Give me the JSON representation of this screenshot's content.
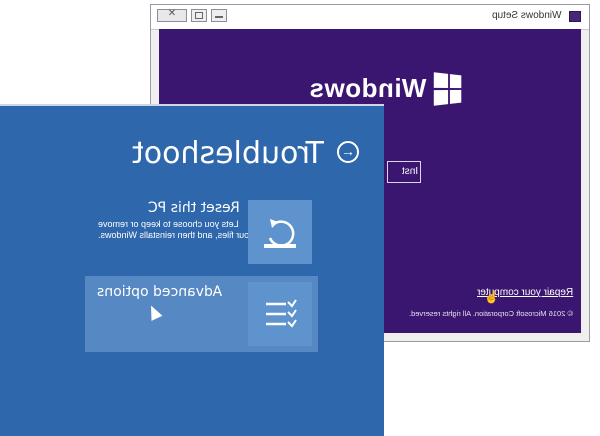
{
  "setup_window": {
    "title": "Windows Setup",
    "logo_text": "Windows",
    "install_button_label": "Inst",
    "repair_link": "Repair your computer",
    "copyright": "© 2016 Microsoft Corporation. All rights reserved.",
    "body_color": "#3b1670"
  },
  "troubleshoot": {
    "title": "Troubleshoot",
    "options": [
      {
        "title": "Reset this PC",
        "description_line1": "Lets you choose to keep or remove",
        "description_line2": "your files, and then reinstalls Windows."
      },
      {
        "title": "Advanced options",
        "description_line1": "",
        "description_line2": ""
      }
    ],
    "panel_color": "#2f67ac",
    "tile_color": "#5e93cd"
  },
  "icons": {
    "back": "back-arrow-icon",
    "reset": "reset-pc-icon",
    "advanced": "checklist-icon",
    "windows": "windows-logo-icon"
  }
}
